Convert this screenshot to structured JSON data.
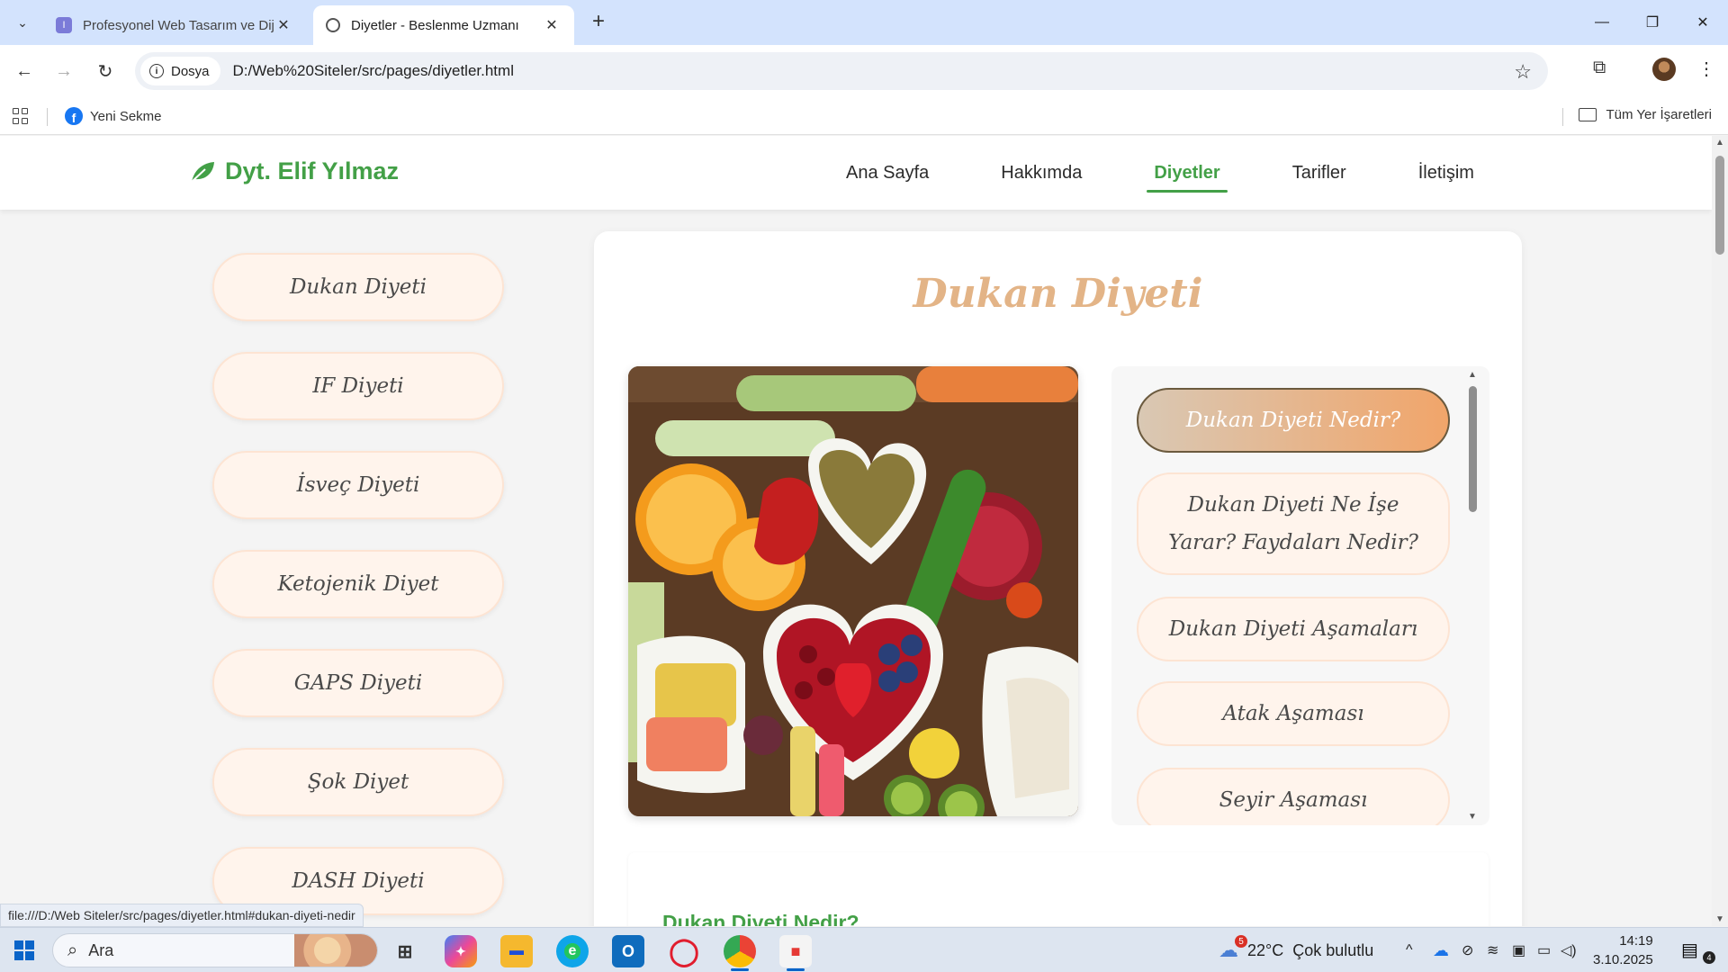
{
  "browser": {
    "tabs": [
      {
        "title": "Profesyonel Web Tasarım ve Dij",
        "active": false
      },
      {
        "title": "Diyetler - Beslenme Uzmanı",
        "active": true
      }
    ],
    "chip_label": "Dosya",
    "url": "D:/Web%20Siteler/src/pages/diyetler.html",
    "bookmark": "Yeni Sekme",
    "all_bookmarks": "Tüm Yer İşaretleri",
    "status_url": "file:///D:/Web Siteler/src/pages/diyetler.html#dukan-diyeti-nedir"
  },
  "site": {
    "logo": "Dyt. Elif Yılmaz",
    "nav": [
      "Ana Sayfa",
      "Hakkımda",
      "Diyetler",
      "Tarifler",
      "İletişim"
    ],
    "active_nav": "Diyetler",
    "accent": "#43a047",
    "title_color": "#e3b487"
  },
  "diet_menu": [
    "Dukan Diyeti",
    "IF Diyeti",
    "İsveç Diyeti",
    "Ketojenik Diyet",
    "GAPS Diyeti",
    "Şok Diyet",
    "DASH Diyeti"
  ],
  "content": {
    "title": "Dukan Diyeti",
    "toc": [
      "Dukan Diyeti Nedir?",
      "Dukan Diyeti Ne İşe Yarar? Faydaları Nedir?",
      "Dukan Diyeti Aşamaları",
      "Atak Aşaması",
      "Seyir Aşaması"
    ],
    "active_toc": "Dukan Diyeti Nedir?",
    "section_title": "Dukan Diyeti Nedir?"
  },
  "taskbar": {
    "search": "Ara",
    "weather_badge": "5",
    "weather": "22°C  Çok bulutlu",
    "time": "14:19",
    "date": "3.10.2025",
    "notifications": "4"
  }
}
